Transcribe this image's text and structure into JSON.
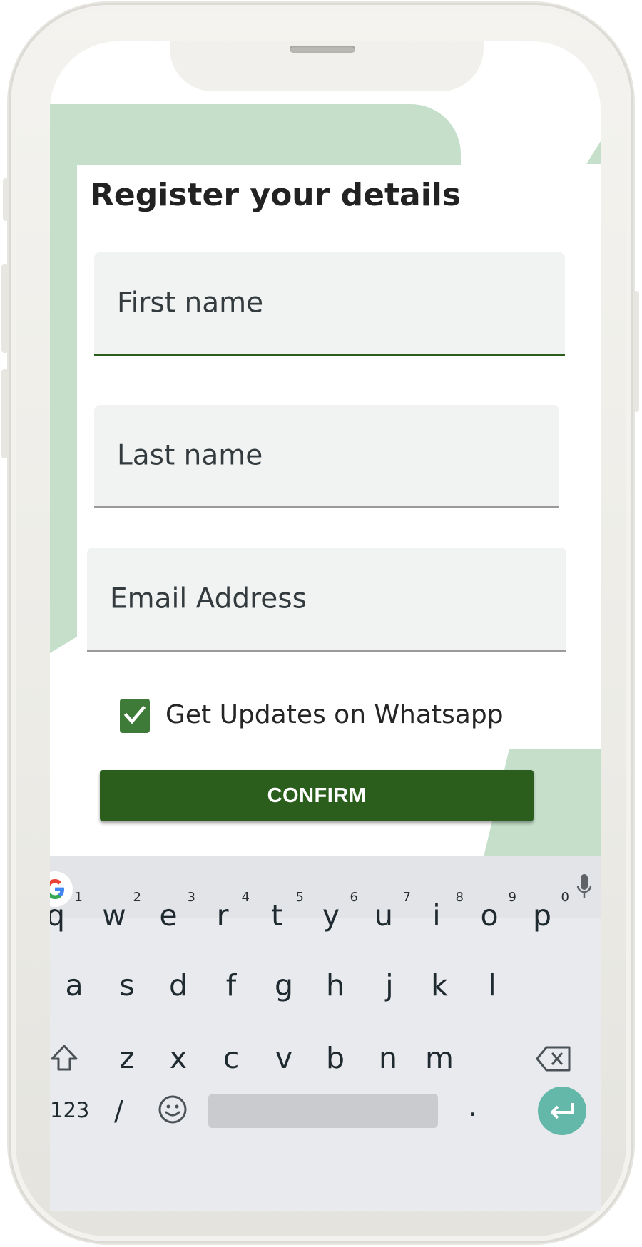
{
  "form": {
    "title": "Register your details",
    "first_name_placeholder": "First name",
    "last_name_placeholder": "Last name",
    "email_placeholder": "Email Address",
    "whatsapp_label": "Get Updates on Whatsapp",
    "whatsapp_checked": true,
    "confirm_label": "CONFIRM"
  },
  "colors": {
    "primary_green": "#2b5e1c",
    "checkbox_green": "#3e7a38",
    "decor_green": "#c5dfcb",
    "field_bg": "#f1f3f2",
    "keyboard_bg": "#e8eaed",
    "enter_key": "#63b8a9"
  },
  "keyboard": {
    "row1": [
      "q",
      "w",
      "e",
      "r",
      "t",
      "y",
      "u",
      "i",
      "o",
      "p"
    ],
    "row1_hints": [
      "1",
      "2",
      "3",
      "4",
      "5",
      "6",
      "7",
      "8",
      "9",
      "0"
    ],
    "row2": [
      "a",
      "s",
      "d",
      "f",
      "g",
      "h",
      "j",
      "k",
      "l"
    ],
    "row3": [
      "z",
      "x",
      "c",
      "v",
      "b",
      "n",
      "m"
    ],
    "numbers_key": "123",
    "slash_key": "/",
    "period_key": ".",
    "icons": [
      "google-logo-icon",
      "mic-icon",
      "shift-icon",
      "backspace-icon",
      "emoji-icon",
      "enter-icon"
    ]
  }
}
